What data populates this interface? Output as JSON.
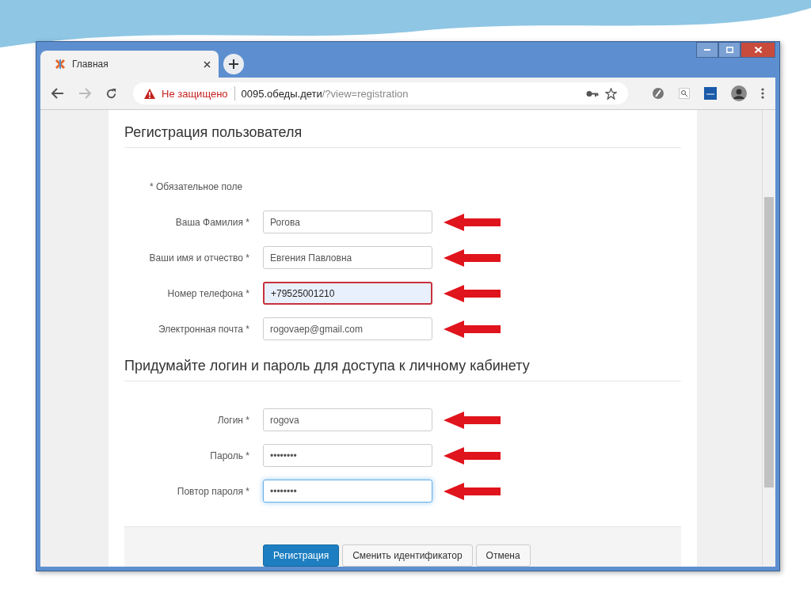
{
  "tabs": [
    {
      "title": "Главная",
      "selected": true
    }
  ],
  "address_bar": {
    "security": "Не защищено",
    "host": "0095.обеды.дети",
    "path": "/?view=registration"
  },
  "form": {
    "title": "Регистрация пользователя",
    "required_note": "* Обязательное поле",
    "sections": [
      {
        "fields": [
          {
            "label": "Ваша Фамилия *",
            "value": "Рогова",
            "invalid": false,
            "focused": false,
            "arrow": true
          },
          {
            "label": "Ваши имя и отчество *",
            "value": "Евгения Павловна",
            "invalid": false,
            "focused": false,
            "arrow": true
          },
          {
            "label": "Номер телефона *",
            "value": "+79525001210",
            "invalid": true,
            "focused": false,
            "arrow": true
          },
          {
            "label": "Электронная почта *",
            "value": "rogovaep@gmail.com",
            "invalid": false,
            "focused": false,
            "arrow": true
          }
        ]
      },
      {
        "title": "Придумайте логин и пароль для доступа к личному кабинету",
        "fields": [
          {
            "label": "Логин *",
            "value": "rogova",
            "invalid": false,
            "focused": false,
            "arrow": true
          },
          {
            "label": "Пароль *",
            "value": "••••••••",
            "invalid": false,
            "focused": false,
            "arrow": true
          },
          {
            "label": "Повтор пароля *",
            "value": "••••••••",
            "invalid": false,
            "focused": true,
            "arrow": true
          }
        ]
      }
    ]
  },
  "buttons": [
    {
      "label": "Регистрация",
      "kind": "primary"
    },
    {
      "label": "Сменить идентификатор",
      "kind": "default"
    },
    {
      "label": "Отмена",
      "kind": "default"
    }
  ]
}
